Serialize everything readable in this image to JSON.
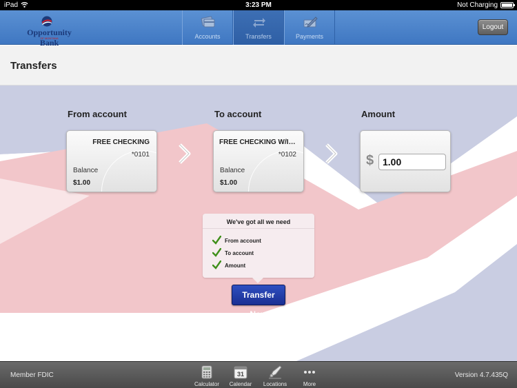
{
  "status_bar": {
    "carrier": "iPad",
    "time": "3:23 PM",
    "battery_status": "Not Charging"
  },
  "header": {
    "logo": {
      "name": "Opportunity Bank",
      "tagline": "OF MONTANA"
    },
    "tabs": [
      {
        "label": "Accounts",
        "icon": "accounts-icon",
        "active": false
      },
      {
        "label": "Transfers",
        "icon": "transfers-icon",
        "active": true
      },
      {
        "label": "Payments",
        "icon": "payments-icon",
        "active": false
      }
    ],
    "logout_label": "Logout"
  },
  "page": {
    "title": "Transfers"
  },
  "transfer": {
    "from": {
      "label": "From account",
      "account_name": "FREE CHECKING",
      "account_number": "*0101",
      "balance_label": "Balance",
      "balance": "$1.00"
    },
    "to": {
      "label": "To account",
      "account_name": "FREE CHECKING W/INTEREST",
      "account_number": "*0102",
      "balance_label": "Balance",
      "balance": "$1.00"
    },
    "amount": {
      "label": "Amount",
      "currency": "$",
      "value": "1.00"
    }
  },
  "checklist": {
    "title": "We've got all we need",
    "items": [
      "From account",
      "To account",
      "Amount"
    ]
  },
  "transfer_button_label": "Transfer Now",
  "bottom_bar": {
    "left_text": "Member FDIC",
    "version": "Version 4.7.435Q",
    "tools": [
      {
        "label": "Calculator",
        "icon": "calculator-icon"
      },
      {
        "label": "Calendar",
        "icon": "calendar-icon",
        "day": "31"
      },
      {
        "label": "Locations",
        "icon": "locations-icon"
      },
      {
        "label": "More",
        "icon": "more-icon"
      }
    ]
  },
  "colors": {
    "header_blue": "#4a82ca",
    "button_blue": "#1f3aa5",
    "check_green": "#3f8f1a",
    "flag_red": "#f2c6ca",
    "flag_blue": "#c9cde2"
  }
}
